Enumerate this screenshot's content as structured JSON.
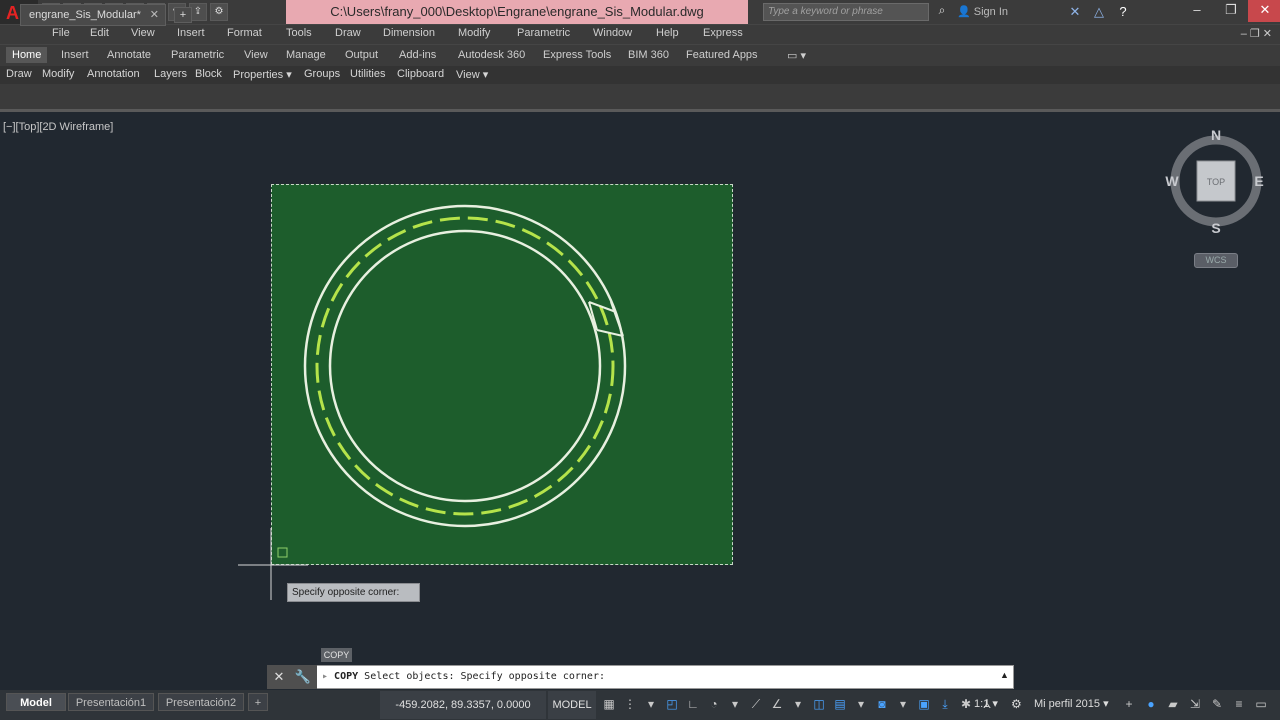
{
  "titlebar": {
    "title": "C:\\Users\\frany_000\\Desktop\\Engrane\\engrane_Sis_Modular.dwg",
    "search_placeholder": "Type a keyword or phrase",
    "signin_label": "Sign In",
    "app_logo": "A",
    "qat_icons": [
      "new-icon",
      "open-icon",
      "save-icon",
      "saveas-icon",
      "plot-icon",
      "undo-icon",
      "redo-icon",
      "share-icon",
      "workspace-icon"
    ],
    "min_label": "–",
    "restore_label": "❐",
    "close_label": "✕"
  },
  "menubar": {
    "items": [
      "File",
      "Edit",
      "View",
      "Insert",
      "Format",
      "Tools",
      "Draw",
      "Dimension",
      "Modify",
      "Parametric",
      "Window",
      "Help",
      "Express"
    ]
  },
  "ribbon": {
    "tabs": [
      "Home",
      "Insert",
      "Annotate",
      "Parametric",
      "View",
      "Manage",
      "Output",
      "Add-ins",
      "Autodesk 360",
      "Express Tools",
      "BIM 360",
      "Featured Apps"
    ],
    "active_tab": "Home"
  },
  "panels": {
    "items": [
      "Draw",
      "Modify",
      "Annotation",
      "Layers",
      "Block",
      "Properties ▾",
      "Groups",
      "Utilities",
      "Clipboard",
      "View ▾"
    ]
  },
  "doc_tabs": {
    "active": "engrane_Sis_Modular*",
    "close": "✕",
    "add": "+"
  },
  "viewport": {
    "label": "[−][Top][2D Wireframe]",
    "viewcube_face": "TOP",
    "north": "N",
    "south": "S",
    "east": "E",
    "west": "W",
    "ucs_label": "WCS",
    "tooltip": "Specify opposite corner:",
    "copy_tag": "COPY"
  },
  "cmdline": {
    "command": "COPY",
    "prompt": "Select objects: Specify opposite corner:"
  },
  "statusbar": {
    "layout_tabs": [
      "Model",
      "Presentación1",
      "Presentación2"
    ],
    "active_layout": "Model",
    "coords": "-459.2082, 89.3357, 0.0000",
    "model": "MODEL",
    "scale": "1:1 ▾",
    "workspace": "Mi perfil 2015 ▾"
  },
  "colors": {
    "selection_fill": "#1d5d2c",
    "gear_outline": "#e8f0e0",
    "pitch_circle": "#b5e34a",
    "viewport_bg": "#212830",
    "title_highlight": "#e8a9b1"
  }
}
